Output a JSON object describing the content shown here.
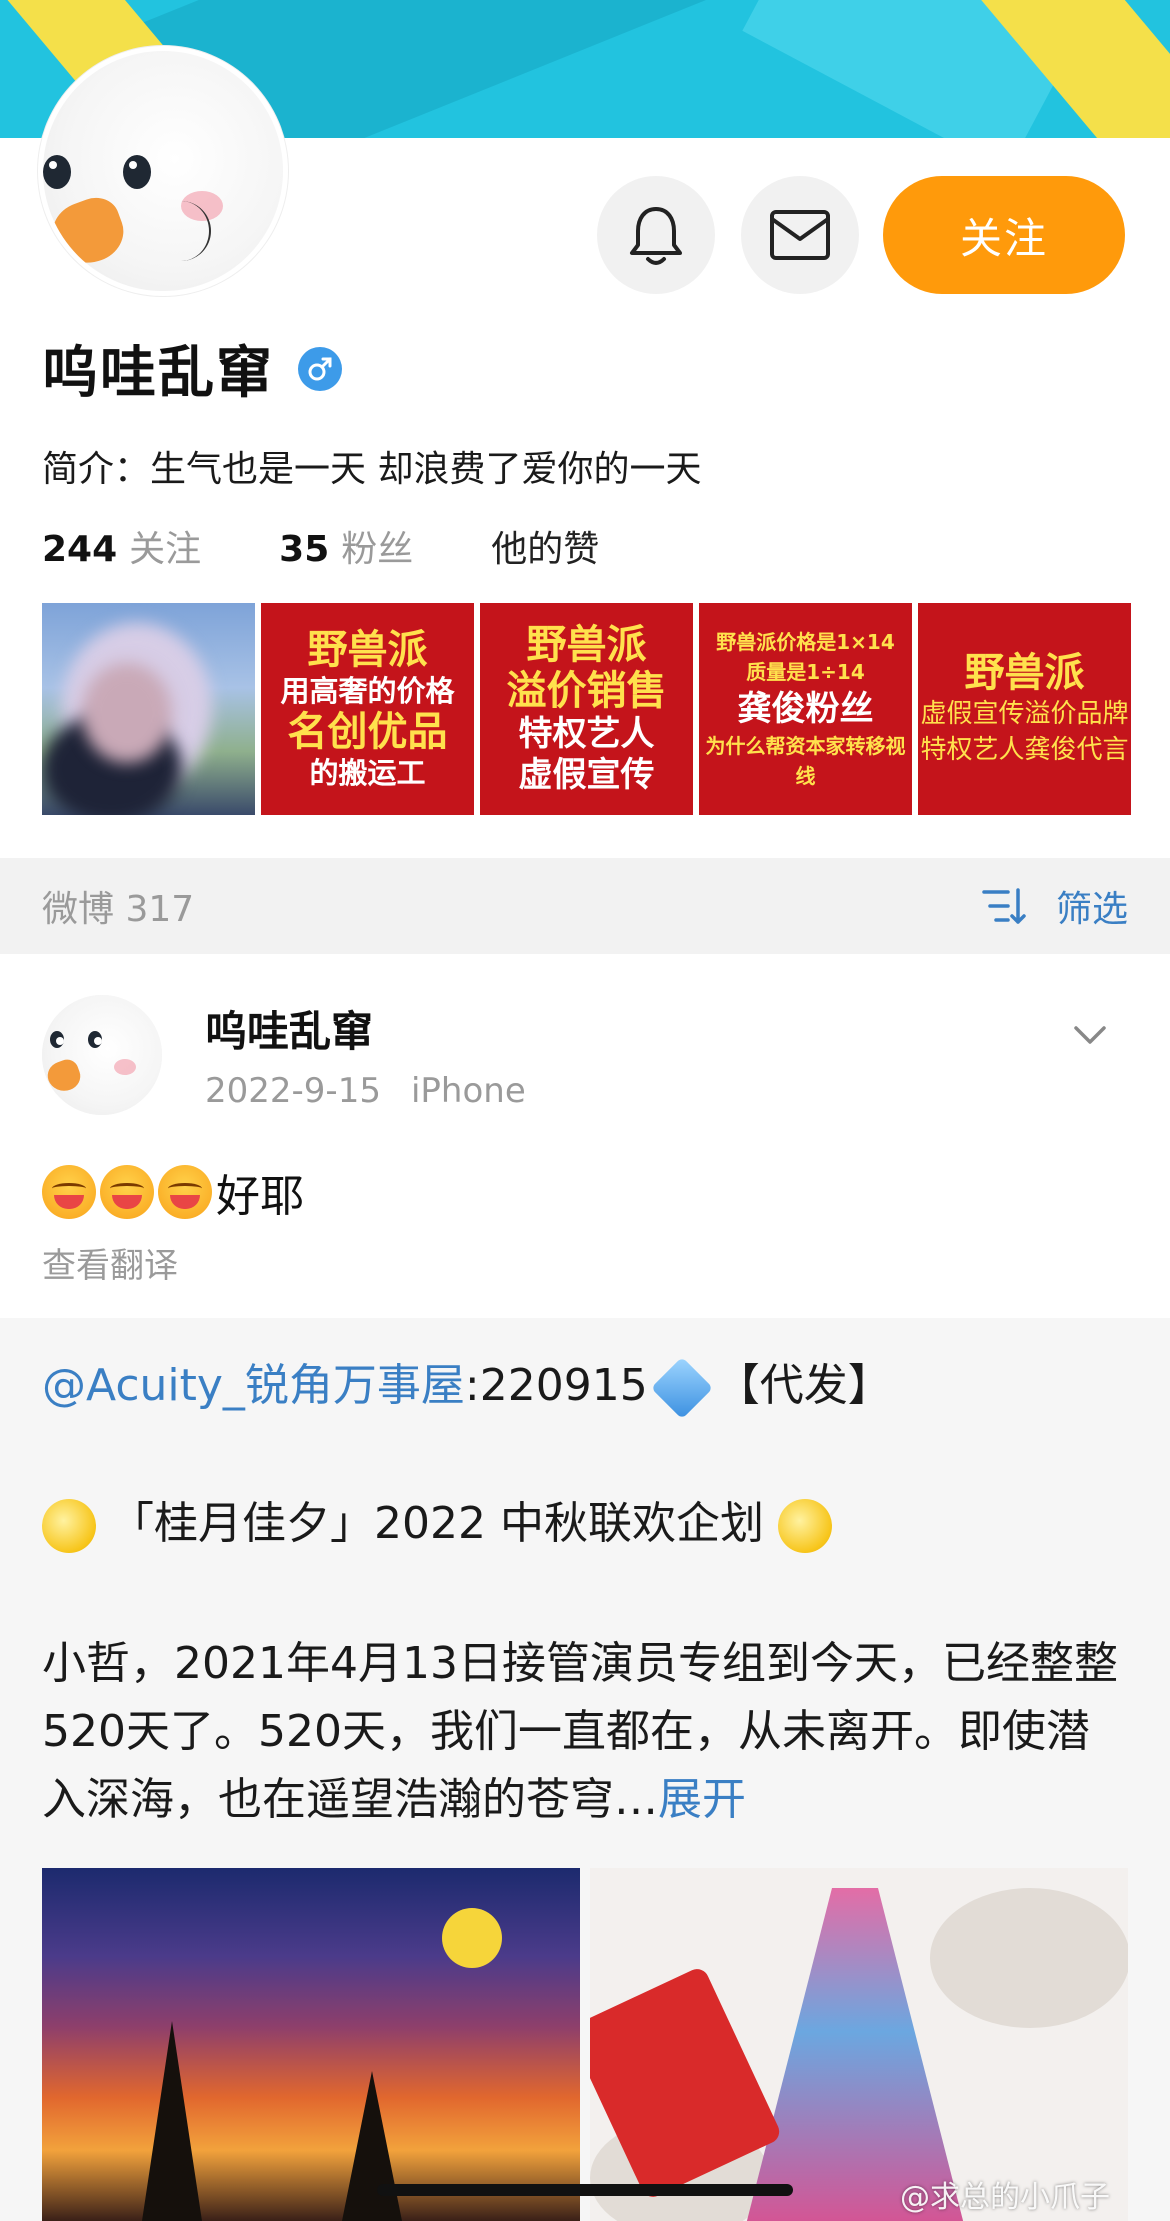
{
  "profile": {
    "name": "呜哇乱窜",
    "follow_label": "关注",
    "bio_label": "简介：",
    "bio_text": "生气也是一天 却浪费了爱你的一天",
    "stats": {
      "following_count": "244",
      "following_label": "关注",
      "followers_count": "35",
      "followers_label": "粉丝",
      "likes_label": "他的赞"
    }
  },
  "album": [
    {
      "lines": []
    },
    {
      "lines": [
        "野兽派",
        "用高奢的价格",
        "名创优品",
        "的搬运工"
      ]
    },
    {
      "lines": [
        "野兽派",
        "溢价销售",
        "特权艺人",
        "虚假宣传"
      ]
    },
    {
      "lines": [
        "野兽派价格是1×14",
        "质量是1÷14",
        "龚俊粉丝",
        "为什么帮资本家转移视线"
      ]
    },
    {
      "lines": [
        "野兽派",
        "虚假宣传溢价品牌",
        "特权艺人龚俊代言"
      ]
    }
  ],
  "weibo_bar": {
    "count_label": "微博 317",
    "filter_label": "筛选"
  },
  "post": {
    "author": "呜哇乱窜",
    "date": "2022-9-15",
    "device": "iPhone",
    "text": "好耶",
    "translate_label": "查看翻译"
  },
  "repost": {
    "mention": "@Acuity_锐角万事屋",
    "head_text": ":220915",
    "head_tail": "【代发】",
    "title": "「桂月佳夕」2022 中秋联欢企划",
    "paragraph": "小哲，2021年4月13日接管演员专组到今天，已经整整520天了。520天，我们一直都在，从未离开。即使潜入深海，也在遥望浩瀚的苍穹…",
    "expand_label": "展开"
  },
  "watermark": "@求总的小爪子",
  "colors": {
    "accent": "#ff9a0b",
    "link": "#3a7fc4",
    "cover": "#22c3df"
  }
}
